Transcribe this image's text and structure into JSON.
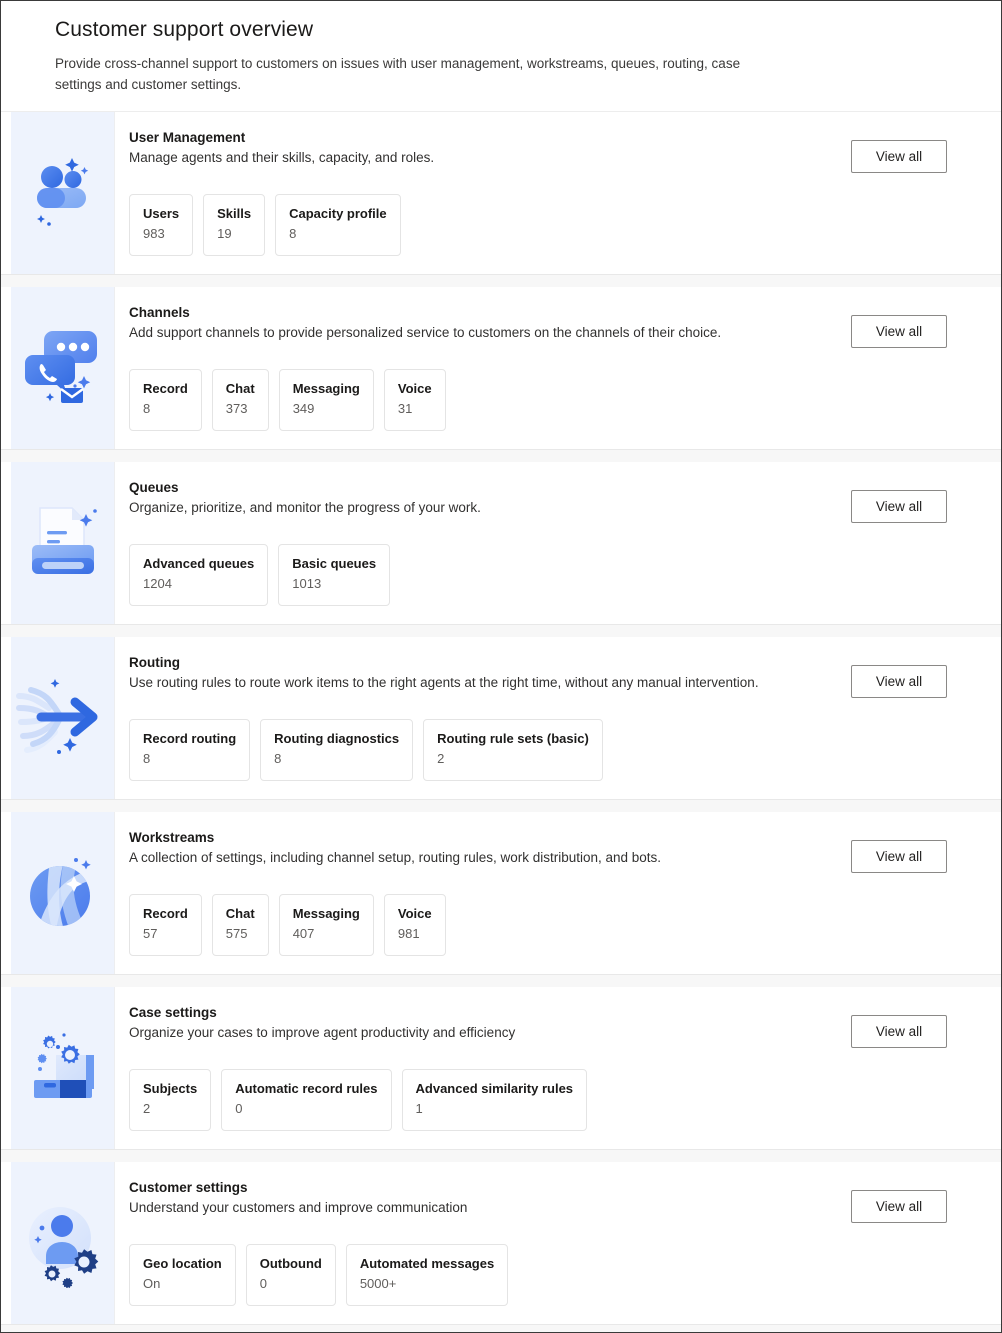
{
  "header": {
    "title": "Customer support overview",
    "subtitle": "Provide cross-channel support to customers on issues with user management, workstreams, queues, routing, case settings and customer settings."
  },
  "common": {
    "view_all_label": "View all",
    "accent_color": "#4b7bec",
    "icon_panel_color": "#eef3fd",
    "page_background": "#f7f7f7"
  },
  "cards": [
    {
      "icon": "people-icon",
      "title": "User Management",
      "description": "Manage agents and their skills, capacity, and roles.",
      "view_all_label": "View all",
      "stats": [
        {
          "label": "Users",
          "value": "983"
        },
        {
          "label": "Skills",
          "value": "19"
        },
        {
          "label": "Capacity profile",
          "value": "8"
        }
      ]
    },
    {
      "icon": "channels-chat-call-icon",
      "title": "Channels",
      "description": "Add support channels to provide personalized service to customers on the channels of their choice.",
      "view_all_label": "View all",
      "stats": [
        {
          "label": "Record",
          "value": "8"
        },
        {
          "label": "Chat",
          "value": "373"
        },
        {
          "label": "Messaging",
          "value": "349"
        },
        {
          "label": "Voice",
          "value": "31"
        }
      ]
    },
    {
      "icon": "queue-printer-document-icon",
      "title": "Queues",
      "description": "Organize, prioritize, and monitor the progress of your work.",
      "view_all_label": "View all",
      "stats": [
        {
          "label": "Advanced queues",
          "value": "1204"
        },
        {
          "label": "Basic queues",
          "value": "1013"
        }
      ]
    },
    {
      "icon": "routing-arrow-icon",
      "title": "Routing",
      "description": "Use routing rules to route work items to the right agents at the right time, without any manual intervention.",
      "view_all_label": "View all",
      "stats": [
        {
          "label": "Record routing",
          "value": "8"
        },
        {
          "label": "Routing diagnostics",
          "value": "8"
        },
        {
          "label": "Routing rule sets (basic)",
          "value": "2"
        }
      ]
    },
    {
      "icon": "workstreams-sphere-icon",
      "title": "Workstreams",
      "description": "A collection of settings, including channel setup, routing rules, work distribution, and bots.",
      "view_all_label": "View all",
      "stats": [
        {
          "label": "Record",
          "value": "57"
        },
        {
          "label": "Chat",
          "value": "575"
        },
        {
          "label": "Messaging",
          "value": "407"
        },
        {
          "label": "Voice",
          "value": "981"
        }
      ]
    },
    {
      "icon": "case-settings-gears-box-icon",
      "title": "Case settings",
      "description": "Organize your cases to improve agent productivity and efficiency",
      "view_all_label": "View all",
      "stats": [
        {
          "label": "Subjects",
          "value": "2"
        },
        {
          "label": "Automatic record rules",
          "value": "0"
        },
        {
          "label": "Advanced similarity rules",
          "value": "1"
        }
      ]
    },
    {
      "icon": "customer-settings-person-gears-icon",
      "title": "Customer settings",
      "description": "Understand your customers and improve communication",
      "view_all_label": "View all",
      "stats": [
        {
          "label": "Geo location",
          "value": "On"
        },
        {
          "label": "Outbound",
          "value": "0"
        },
        {
          "label": "Automated messages",
          "value": "5000+"
        }
      ]
    }
  ]
}
